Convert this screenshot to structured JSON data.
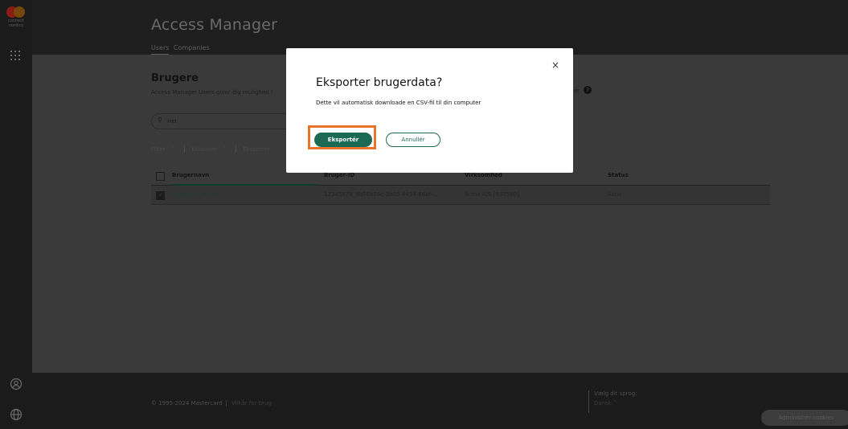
{
  "brand": {
    "logo_text_1": "connect",
    "logo_text_2": "nordics"
  },
  "header": {
    "title": "Access Manager",
    "tabs": [
      {
        "label": "Users",
        "active": true
      },
      {
        "label": "Companies",
        "active": false
      }
    ]
  },
  "page": {
    "title": "Brugere",
    "description": "Access Manager Users giver dig mulighed f",
    "description_tail": "er",
    "search": {
      "value": "Hel"
    },
    "toolbar": {
      "filter": "Filter",
      "columns": "Kolonner",
      "export": "Eksportér"
    }
  },
  "table": {
    "columns": [
      "Brugernavn",
      "Bruger-ID",
      "Virksomhed",
      "Status"
    ],
    "rows": [
      {
        "checked": true,
        "username": "Andersen, Helle",
        "user_id": "12345678_9b06a56c-3b05-4494-86bf-...",
        "company": "Acme A/S [937590]",
        "status": "Aktiv"
      }
    ]
  },
  "modal": {
    "title": "Eksporter brugerdata?",
    "description": "Dette vil automatisk downloade en CSV-fil til din computer",
    "primary_button": "Eksportér",
    "secondary_button": "Annullér",
    "close_glyph": "×"
  },
  "footer": {
    "copyright": "© 1995-2024 Mastercard",
    "terms": "Vilkår for brug",
    "language_label": "Vælg dit sprog:",
    "language_value": "Dansk",
    "cookies_button": "Administrér cookies"
  },
  "colors": {
    "accent": "#1c6a55",
    "focus": "#e7742a",
    "overlay": "#3a3a3a"
  }
}
